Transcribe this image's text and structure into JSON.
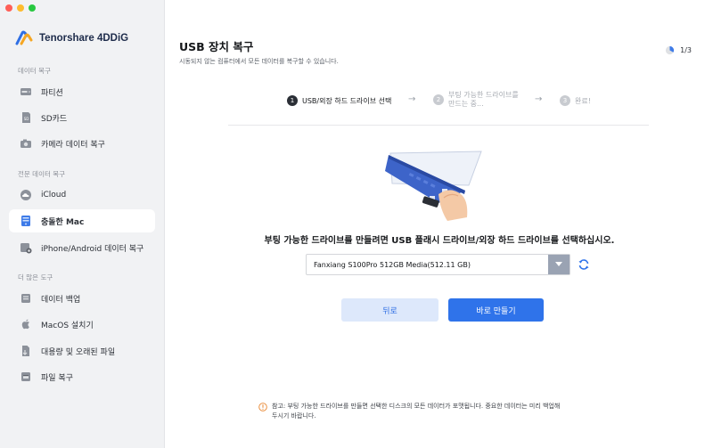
{
  "app": {
    "name": "Tenorshare 4DDiG"
  },
  "sidebar": {
    "sections": [
      {
        "label": "데이터 복구",
        "items": [
          {
            "label": "파티션",
            "icon": "partition-icon"
          },
          {
            "label": "SD카드",
            "icon": "sd-card-icon"
          },
          {
            "label": "카메라 데이터 복구",
            "icon": "camera-icon"
          }
        ]
      },
      {
        "label": "전문 데이터 복구",
        "items": [
          {
            "label": "iCloud",
            "icon": "icloud-icon"
          },
          {
            "label": "충돌한 Mac",
            "icon": "crashed-mac-icon",
            "active": true
          },
          {
            "label": "iPhone/Android 데이터 복구",
            "icon": "phone-recovery-icon"
          }
        ]
      },
      {
        "label": "더 많은 도구",
        "items": [
          {
            "label": "데이터 백업",
            "icon": "backup-icon"
          },
          {
            "label": "MacOS 설치기",
            "icon": "macos-installer-icon"
          },
          {
            "label": "대용량 및 오래된 파일",
            "icon": "large-files-icon"
          },
          {
            "label": "파일 복구",
            "icon": "file-repair-icon"
          }
        ]
      }
    ]
  },
  "main": {
    "title": "USB 장치 복구",
    "subtitle": "시동되지 않는 컴퓨터에서 모든 데이터를 복구할 수 있습니다.",
    "page_counter": "1/3",
    "steps": [
      {
        "num": "1",
        "label": "USB/외장 하드 드라이브 선택",
        "active": true
      },
      {
        "num": "2",
        "label_line1": "부팅 가능한 드라이브를",
        "label_line2": "만드는 중...",
        "active": false
      },
      {
        "num": "3",
        "label": "완료!",
        "active": false
      }
    ],
    "instruction": "부팅 가능한 드라이브를 만들려면 USB 플래시 드라이브/외장 하드 드라이브를 선택하십시오.",
    "drive_select": {
      "value": "Fanxiang S100Pro 512GB Media(512.11 GB)"
    },
    "buttons": {
      "back": "뒤로",
      "create": "바로 만들기"
    },
    "notice_line1": "참고: 부팅 가능한 드라이브를 만들면 선택한 디스크의 모든 데이터가 포맷됩니다. 중요한 데이터는 미리 백업해",
    "notice_line2": "두시기 바랍니다."
  },
  "colors": {
    "accent": "#2f73ea",
    "accent_light": "#dde8fb",
    "sidebar_bg": "#f1f2f4"
  }
}
